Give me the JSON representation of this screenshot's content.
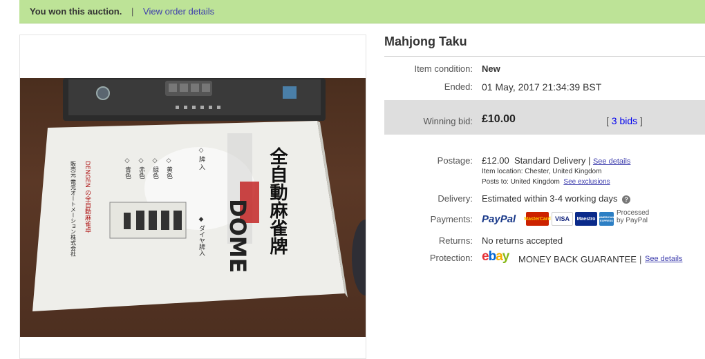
{
  "banner": {
    "message": "You won this auction.",
    "separator": "|",
    "link": "View order details"
  },
  "item": {
    "title": "Mahjong Taku"
  },
  "photo": {
    "box_title_vertical": "全自動麻雀牌",
    "brand_vertical": "DOME",
    "maker_vertical": "DENGEN の全自動麻雀卓",
    "company_vertical": "販売元 電元オートメーション株式会社",
    "colors_col1": "◇ 黄色",
    "colors_col2": "◇ 緑色",
    "colors_col3": "◇ 赤色",
    "colors_col4": "◇ 青色",
    "note_vertical": "◆ ダイヤ牌入",
    "note2_vertical": "◇ 牌 入"
  },
  "details": {
    "condition": {
      "label": "Item condition:",
      "value": "New"
    },
    "ended": {
      "label": "Ended:",
      "value": "01 May, 2017  21:34:39 BST"
    },
    "winning_bid": {
      "label": "Winning bid:",
      "value": "£10.00",
      "bids_open": "[",
      "bids_link": "3 bids",
      "bids_close": "]"
    },
    "postage": {
      "label": "Postage:",
      "price": "£12.00",
      "method": "Standard Delivery",
      "sep": "|",
      "link": "See details",
      "location_label": "Item location:",
      "location": "Chester, United Kingdom",
      "posts_label": "Posts to:",
      "posts": "United Kingdom",
      "exclusions": "See exclusions"
    },
    "delivery": {
      "label": "Delivery:",
      "value": "Estimated within 3-4 working days",
      "help_icon": "?"
    },
    "payments": {
      "label": "Payments:",
      "paypal": "PayPal",
      "mastercard": "MasterCard",
      "visa": "VISA",
      "maestro": "Maestro",
      "amex": "AMERICAN EXPRESS",
      "processed": "Processed",
      "by_paypal": "by PayPal"
    },
    "returns": {
      "label": "Returns:",
      "value": "No returns accepted"
    },
    "protection": {
      "label": "Protection:",
      "ebay": "ebay",
      "guarantee": "MONEY BACK GUARANTEE",
      "sep": "|",
      "link": "See details"
    }
  },
  "colors": {
    "banner_bg": "#bde397",
    "link": "#3d3dad",
    "bid_box": "#dedede"
  }
}
